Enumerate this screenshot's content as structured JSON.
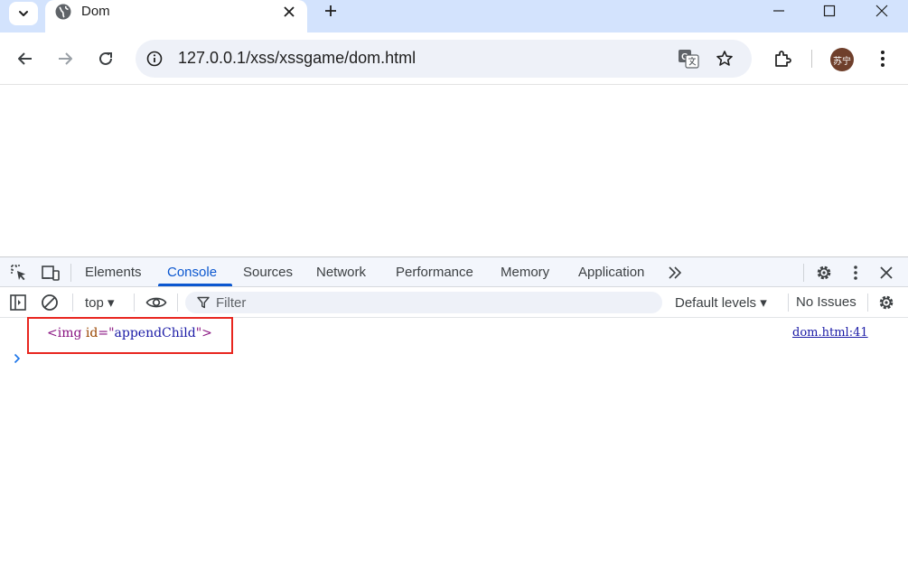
{
  "browser": {
    "tab": {
      "title": "Dom"
    },
    "url": "127.0.0.1/xss/xssgame/dom.html",
    "profile_initials": "苏宁"
  },
  "devtools": {
    "tabs": [
      "Elements",
      "Console",
      "Sources",
      "Network",
      "Performance",
      "Memory",
      "Application"
    ],
    "active_tab": "Console",
    "context": "top ▾",
    "filter_placeholder": "Filter",
    "levels": "Default levels ▾",
    "issues": "No Issues"
  },
  "console": {
    "log": {
      "open_bracket": "<img",
      "attr_name": " id",
      "attr_eq": "=\"",
      "attr_value": "appendChild",
      "close": "\">",
      "source": "dom.html:41"
    }
  },
  "colors": {
    "tabstrip": "#d3e3fd",
    "accent": "#0b57d0",
    "highlight": "#e8261f"
  },
  "icons": [
    "tab-search-icon",
    "globe-icon",
    "close-icon",
    "plus-icon",
    "minimize-icon",
    "maximize-icon",
    "back-icon",
    "forward-icon",
    "reload-icon",
    "site-info-icon",
    "translate-icon",
    "star-icon",
    "extensions-icon",
    "more-vert-icon",
    "inspect-icon",
    "device-icon",
    "more-tabs-icon",
    "settings-icon",
    "sidebar-icon",
    "clear-icon",
    "eye-icon",
    "filter-icon",
    "chevron-right-icon"
  ]
}
